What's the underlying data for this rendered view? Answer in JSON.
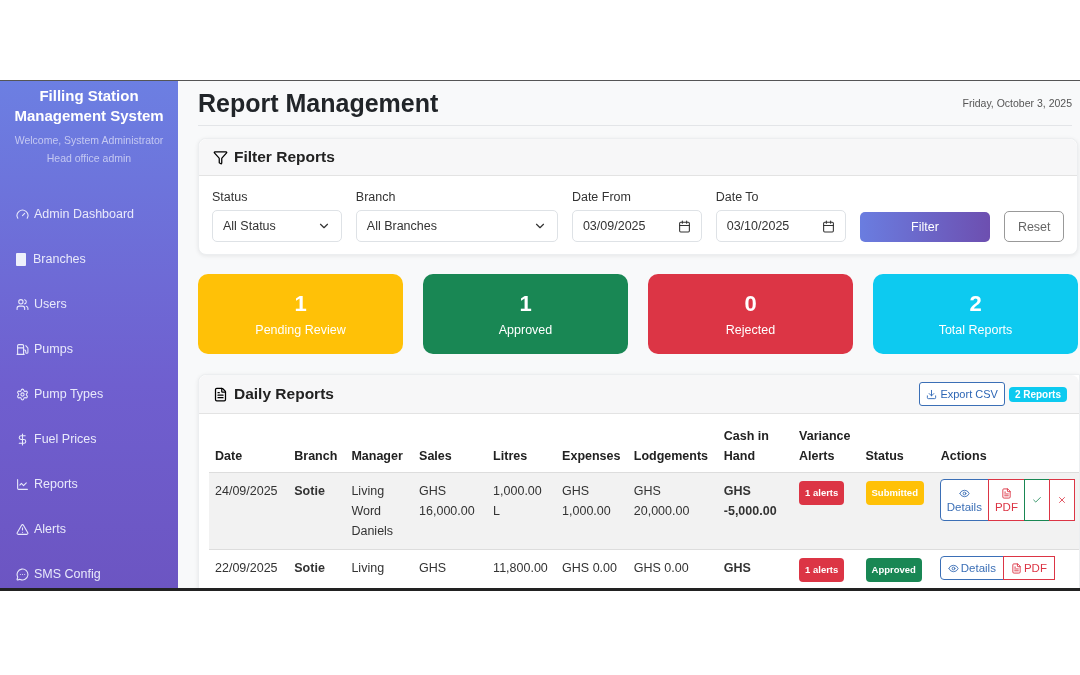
{
  "sidebar": {
    "title": "Filling Station Management System",
    "welcome": "Welcome, System Administrator",
    "role": "Head office admin",
    "items": [
      {
        "label": "Admin Dashboard"
      },
      {
        "label": "Branches"
      },
      {
        "label": "Users"
      },
      {
        "label": "Pumps"
      },
      {
        "label": "Pump Types"
      },
      {
        "label": "Fuel Prices"
      },
      {
        "label": "Reports"
      },
      {
        "label": "Alerts"
      },
      {
        "label": "SMS Config"
      }
    ]
  },
  "header": {
    "title": "Report Management",
    "date": "Friday, October 3, 2025"
  },
  "filter": {
    "title": "Filter Reports",
    "fields": [
      {
        "kind": "select",
        "label": "Status",
        "value": "All Status"
      },
      {
        "kind": "select",
        "label": "Branch",
        "value": "All Branches"
      },
      {
        "kind": "date",
        "label": "Date From",
        "value": "03/09/2025"
      },
      {
        "kind": "date",
        "label": "Date To",
        "value": "03/10/2025"
      }
    ],
    "filter_button": "Filter",
    "reset_button": "Reset"
  },
  "stats": [
    {
      "value": "1",
      "label": "Pending Review",
      "color": "#ffc107"
    },
    {
      "value": "1",
      "label": "Approved",
      "color": "#198754"
    },
    {
      "value": "0",
      "label": "Rejected",
      "color": "#dc3545"
    },
    {
      "value": "2",
      "label": "Total Reports",
      "color": "#0dcaf0"
    }
  ],
  "reports": {
    "title": "Daily Reports",
    "export_button": "Export CSV",
    "count_badge": "2 Reports",
    "table": {
      "columns": [
        "Date",
        "Branch",
        "Manager",
        "Sales",
        "Litres",
        "Expenses",
        "Lodgements",
        "Cash in Hand",
        "Variance Alerts",
        "Status",
        "Actions"
      ],
      "rows": [
        {
          "date": "24/09/2025",
          "branch": "Sotie",
          "manager": "Living Word Daniels",
          "sales": "GHS 16,000.00",
          "litres": "1,000.00 L",
          "expenses": "GHS 1,000.00",
          "lodgements": "GHS 20,000.00",
          "cash_in_hand": "GHS -5,000.00",
          "alerts": "1 alerts",
          "status": {
            "label": "Submitted",
            "color": "#ffc107"
          },
          "highlighted": true,
          "actions": [
            {
              "kind": "details",
              "label": "Details"
            },
            {
              "kind": "pdf",
              "label": "PDF"
            },
            {
              "kind": "approve"
            },
            {
              "kind": "reject"
            }
          ]
        },
        {
          "date": "22/09/2025",
          "branch": "Sotie",
          "manager": "Living",
          "sales": "GHS",
          "litres": "11,800.00",
          "expenses": "GHS 0.00",
          "lodgements": "GHS 0.00",
          "cash_in_hand": "GHS",
          "alerts": "1 alerts",
          "status": {
            "label": "Approved",
            "color": "#198754"
          },
          "highlighted": false,
          "actions": [
            {
              "kind": "details",
              "label": "Details"
            },
            {
              "kind": "pdf",
              "label": "PDF"
            }
          ]
        }
      ]
    }
  }
}
